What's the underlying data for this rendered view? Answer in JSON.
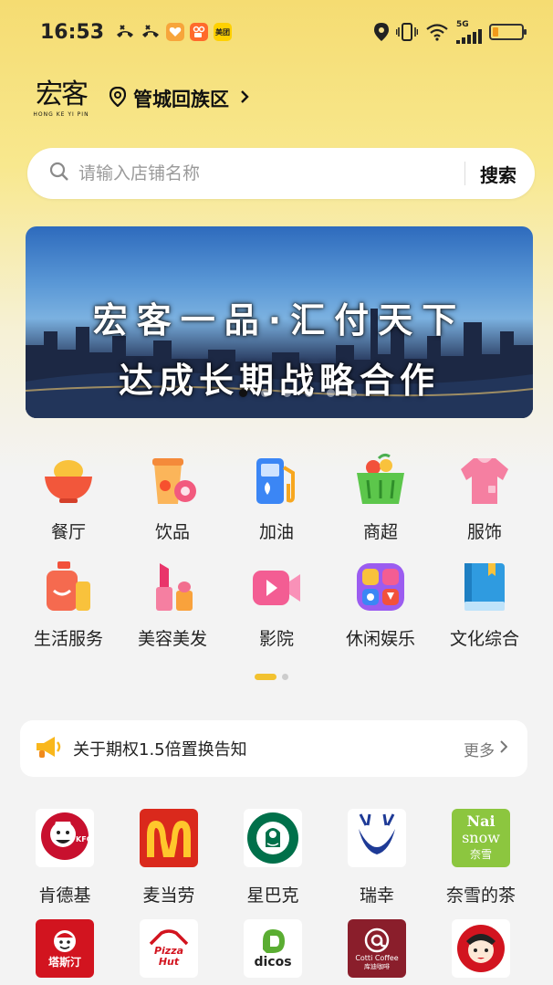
{
  "status_bar": {
    "time": "16:53",
    "network": "5G",
    "app_badges": [
      {
        "icon": "missed-call-icon"
      },
      {
        "icon": "missed-call-icon"
      },
      {
        "icon": "heart-app-icon",
        "color": "#f7a53b"
      },
      {
        "icon": "kuaishou-app-icon",
        "color": "#ff6a2b"
      },
      {
        "icon": "meituan-app-icon",
        "color": "#ffd100",
        "label": "美团"
      }
    ],
    "battery_level": 0.2
  },
  "header": {
    "logo_cn": "宏客",
    "logo_en": "HONG KE YI PIN",
    "location": "管城回族区"
  },
  "search": {
    "placeholder": "请输入店铺名称",
    "button_label": "搜索"
  },
  "banner": {
    "line1": "宏客一品·汇付天下",
    "line2": "达成长期战略合作",
    "slide_count": 6,
    "active_slide": 0
  },
  "categories": [
    {
      "label": "餐厅",
      "icon": "bowl-icon"
    },
    {
      "label": "饮品",
      "icon": "drink-icon"
    },
    {
      "label": "加油",
      "icon": "fuel-pump-icon"
    },
    {
      "label": "商超",
      "icon": "shopping-basket-icon"
    },
    {
      "label": "服饰",
      "icon": "sweater-icon"
    },
    {
      "label": "生活服务",
      "icon": "lotion-bottle-icon"
    },
    {
      "label": "美容美发",
      "icon": "lipstick-icon"
    },
    {
      "label": "影院",
      "icon": "video-camera-icon"
    },
    {
      "label": "休闲娱乐",
      "icon": "entertainment-icon"
    },
    {
      "label": "文化综合",
      "icon": "book-icon"
    }
  ],
  "category_pages": {
    "count": 2,
    "active": 0
  },
  "notice": {
    "text": "关于期权1.5倍置换告知",
    "more_label": "更多"
  },
  "brands": [
    {
      "label": "肯德基",
      "logo": "kfc-logo"
    },
    {
      "label": "麦当劳",
      "logo": "mcdonalds-logo"
    },
    {
      "label": "星巴克",
      "logo": "starbucks-logo"
    },
    {
      "label": "瑞幸",
      "logo": "luckin-logo"
    },
    {
      "label": "奈雪的茶",
      "logo": "naisnow-logo",
      "logo_text_1": "Nai",
      "logo_text_2": "snow",
      "logo_text_3": "奈雪"
    },
    {
      "label": "",
      "logo": "dicos-chinese-logo",
      "logo_text_1": "塔斯汀"
    },
    {
      "label": "",
      "logo": "pizzahut-logo",
      "logo_text_1": "Pizza",
      "logo_text_2": "Hut"
    },
    {
      "label": "",
      "logo": "dicos-logo",
      "logo_text_1": "dicos"
    },
    {
      "label": "",
      "logo": "cotti-coffee-logo",
      "logo_text_1": "Cotti Coffee",
      "logo_text_2": "库迪咖啡"
    },
    {
      "label": "",
      "logo": "chinese-opera-logo"
    }
  ]
}
